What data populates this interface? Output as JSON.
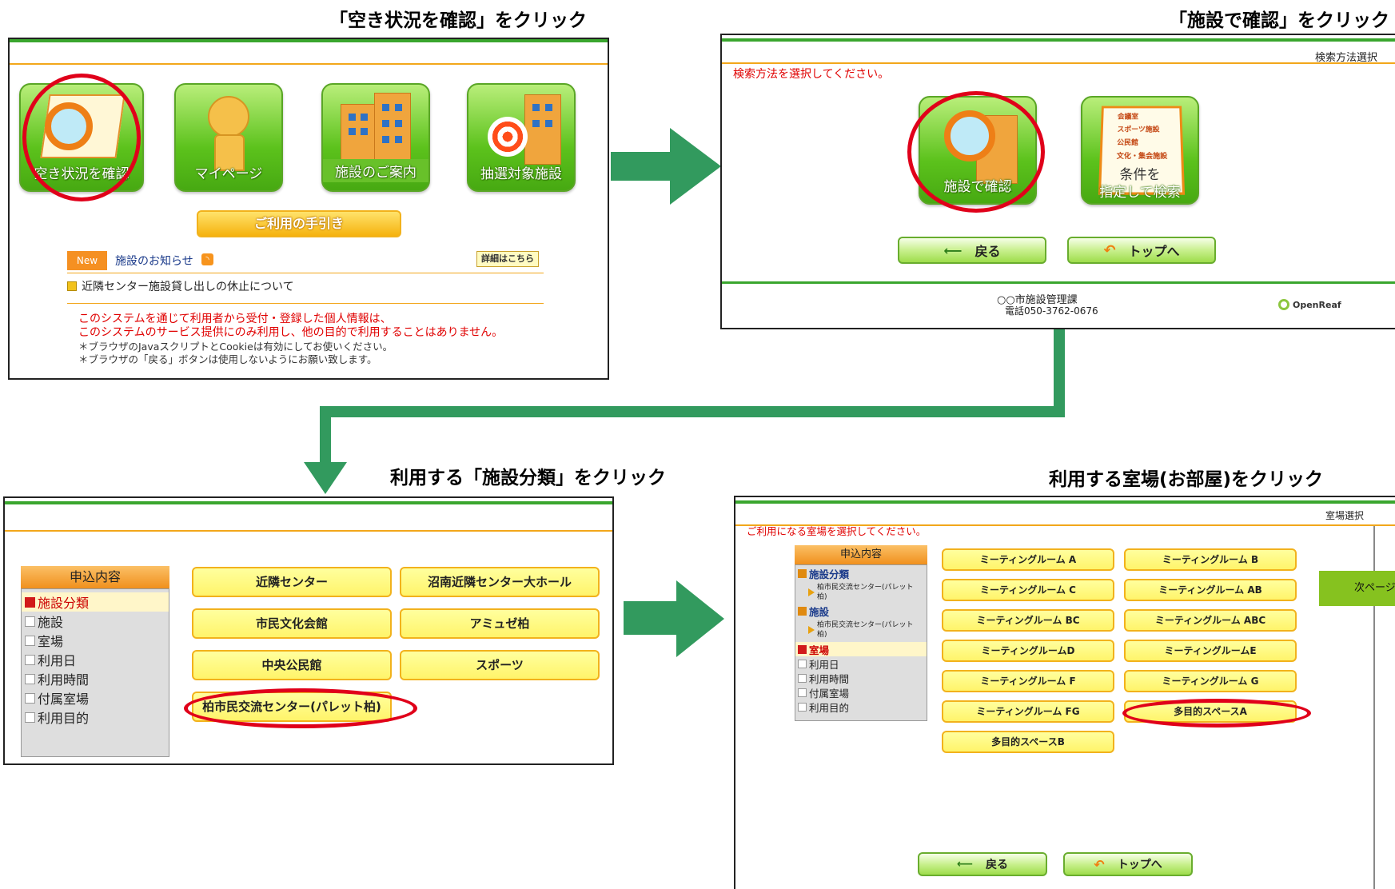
{
  "captions": {
    "step1": "「空き状況を確認」をクリック",
    "step2": "「施設で確認」をクリック",
    "step3": "利用する「施設分類」をクリック",
    "step4": "利用する室場(お部屋)をクリック"
  },
  "panel1": {
    "tiles": [
      "空き状況を確認",
      "マイページ",
      "施設のご案内",
      "抽選対象施設"
    ],
    "guide_button": "ご利用の手引き",
    "new_badge": "New",
    "news_title": "施設のお知らせ",
    "details_button": "詳細はこちら",
    "news_item": "近隣センター施設貸し出しの休止について",
    "notice_red_1": "このシステムを通じて利用者から受付・登録した個人情報は、",
    "notice_red_2": "このシステムのサービス提供にのみ利用し、他の目的で利用することはありません。",
    "notice_1": "＊ブラウザのJavaスクリプトとCookieは有効にしてお使いください。",
    "notice_2": "＊ブラウザの「戻る」ボタンは使用しないようにお願い致します。"
  },
  "panel2": {
    "header_right": "検索方法選択",
    "instruction": "検索方法を選択してください。",
    "tile_facility": "施設で確認",
    "tile_condition_1": "条件を",
    "tile_condition_2": "指定して検索",
    "checklist": [
      "会議室",
      "スポーツ施設",
      "公民館",
      "文化・集会施設"
    ],
    "back_button": "戻る",
    "top_button": "トップへ",
    "footer_line1": "○○市施設管理課",
    "footer_line2": "電話050-3762-0676",
    "brand": "OpenReaf"
  },
  "panel3": {
    "menu_header": "申込内容",
    "menu_items": [
      "施設分類",
      "施設",
      "室場",
      "利用日",
      "利用時間",
      "付属室場",
      "利用目的"
    ],
    "buttons": [
      "近隣センター",
      "沼南近隣センター大ホール",
      "市民文化会館",
      "アミュゼ柏",
      "中央公民館",
      "スポーツ",
      "柏市民交流センター(パレット柏)"
    ]
  },
  "panel4": {
    "header_right": "室場選択",
    "instruction": "ご利用になる室場を選択してください。",
    "menu_header": "申込内容",
    "menu_group1_title": "施設分類",
    "menu_group1_value": "柏市民交流センター(パレット柏)",
    "menu_group2_title": "施設",
    "menu_group2_value": "柏市民交流センター(パレット柏)",
    "menu_active": "室場",
    "menu_items": [
      "利用日",
      "利用時間",
      "付属室場",
      "利用目的"
    ],
    "rooms": [
      "ミーティングルーム A",
      "ミーティングルーム B",
      "ミーティングルーム C",
      "ミーティングルーム AB",
      "ミーティングルーム BC",
      "ミーティングルーム ABC",
      "ミーティングルームD",
      "ミーティングルームE",
      "ミーティングルーム F",
      "ミーティングルーム G",
      "ミーティングルーム FG",
      "多目的スペースA",
      "多目的スペースB"
    ],
    "next_page": "次ページ",
    "back_button": "戻る",
    "top_button": "トップへ"
  },
  "colors": {
    "green_accent": "#3aa62e",
    "arrow": "#329a5e",
    "highlight": "#e0001a",
    "orange_line": "#f2a71b"
  }
}
